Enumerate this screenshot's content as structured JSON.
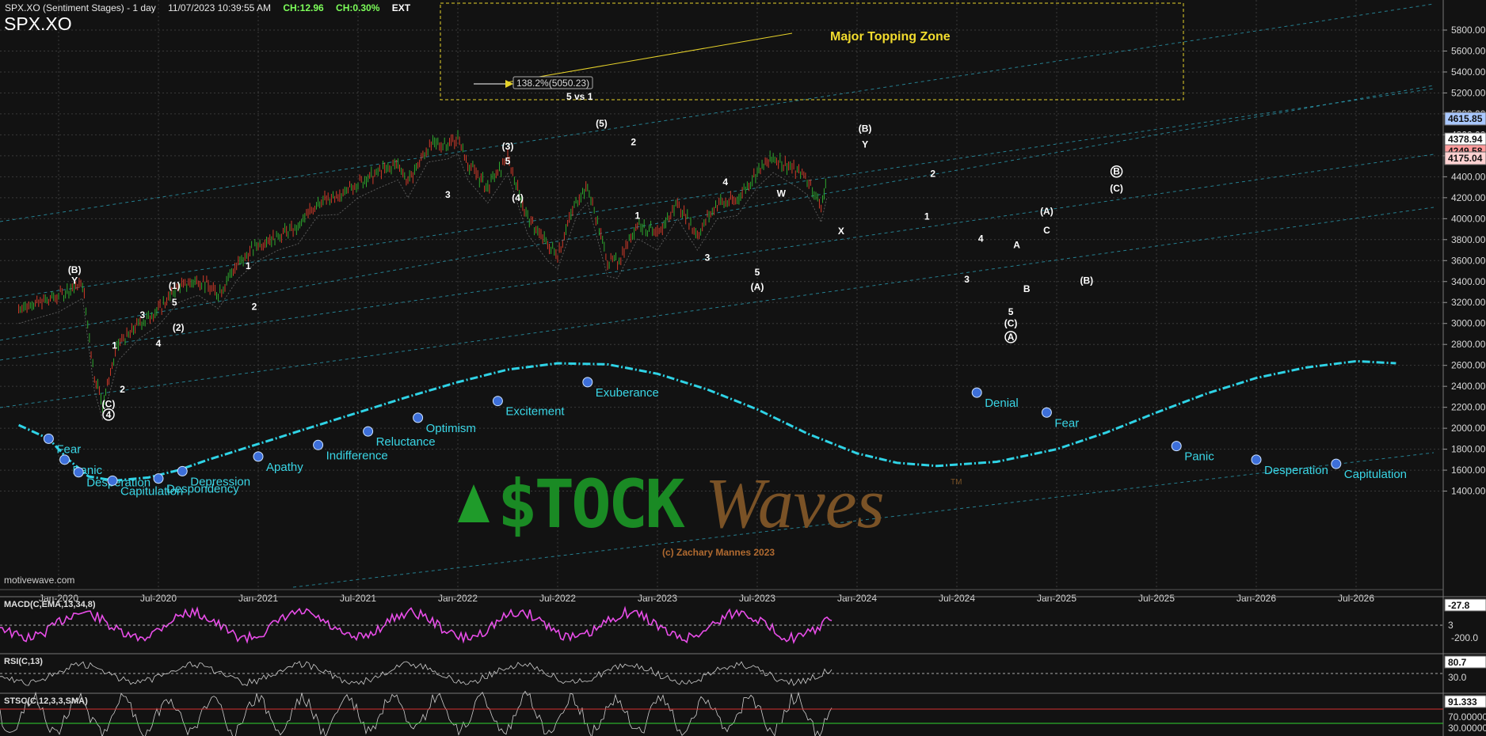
{
  "header": {
    "title": "SPX.XO (Sentiment Stages) - 1 day",
    "datetime": "11/07/2023 10:39:55 AM",
    "change": "CH:12.96",
    "change_pct": "CH:0.30%",
    "session": "EXT",
    "symbol": "SPX.XO"
  },
  "watermark": "motivewave.com",
  "brand": {
    "stock": "STOCK",
    "waves": "Waves",
    "tm": "TM",
    "credit": "(c) Zachary Mannes 2023"
  },
  "zone_label": "Major Topping Zone",
  "fib_label": "138.2%(5050.23)",
  "fib_note": "5 vs 1",
  "colors": {
    "stage_curve": "#2fd3e6",
    "stage_dot": "#3d6fd9",
    "up_candle": "#2ea82e",
    "down_candle": "#d23a2a",
    "zone": "#e6d22a",
    "macd": "#e84de8"
  },
  "chart_data": {
    "type": "line",
    "x_ticks": [
      "Jan-2020",
      "Jul-2020",
      "Jan-2021",
      "Jul-2021",
      "Jan-2022",
      "Jul-2022",
      "Jan-2023",
      "Jul-2023",
      "Jan-2024",
      "Jul-2024",
      "Jan-2025",
      "Jul-2025",
      "Jan-2026",
      "Jul-2026"
    ],
    "y_ticks": [
      1400,
      1600,
      1800,
      2000,
      2200,
      2400,
      2600,
      2800,
      3000,
      3200,
      3400,
      3600,
      3800,
      4000,
      4200,
      4400,
      4600,
      4800,
      5000,
      5200,
      5400,
      5600,
      5800
    ],
    "price_tags": [
      "4615.85",
      "4378.94",
      "4249.58",
      "4175.04"
    ],
    "price_path": [
      [
        2019.8,
        3150
      ],
      [
        2020.0,
        3260
      ],
      [
        2020.12,
        3390
      ],
      [
        2020.18,
        2500
      ],
      [
        2020.22,
        2240
      ],
      [
        2020.3,
        2800
      ],
      [
        2020.4,
        3000
      ],
      [
        2020.5,
        3130
      ],
      [
        2020.6,
        3350
      ],
      [
        2020.7,
        3420
      ],
      [
        2020.8,
        3290
      ],
      [
        2020.9,
        3580
      ],
      [
        2021.0,
        3750
      ],
      [
        2021.1,
        3850
      ],
      [
        2021.2,
        3910
      ],
      [
        2021.3,
        4180
      ],
      [
        2021.4,
        4190
      ],
      [
        2021.5,
        4350
      ],
      [
        2021.6,
        4440
      ],
      [
        2021.7,
        4520
      ],
      [
        2021.75,
        4350
      ],
      [
        2021.85,
        4690
      ],
      [
        2021.95,
        4720
      ],
      [
        2022.0,
        4770
      ],
      [
        2022.05,
        4520
      ],
      [
        2022.15,
        4300
      ],
      [
        2022.25,
        4580
      ],
      [
        2022.35,
        4000
      ],
      [
        2022.45,
        3750
      ],
      [
        2022.5,
        3670
      ],
      [
        2022.6,
        4200
      ],
      [
        2022.65,
        4300
      ],
      [
        2022.75,
        3600
      ],
      [
        2022.8,
        3580
      ],
      [
        2022.9,
        3960
      ],
      [
        2023.0,
        3850
      ],
      [
        2023.1,
        4150
      ],
      [
        2023.2,
        3850
      ],
      [
        2023.3,
        4150
      ],
      [
        2023.4,
        4180
      ],
      [
        2023.5,
        4450
      ],
      [
        2023.58,
        4590
      ],
      [
        2023.7,
        4450
      ],
      [
        2023.75,
        4380
      ],
      [
        2023.82,
        4117
      ],
      [
        2023.85,
        4360
      ]
    ],
    "sentiment_path": [
      [
        2019.8,
        2030
      ],
      [
        2019.95,
        1900
      ],
      [
        2020.05,
        1700
      ],
      [
        2020.15,
        1540
      ],
      [
        2020.28,
        1500
      ],
      [
        2020.45,
        1530
      ],
      [
        2020.6,
        1600
      ],
      [
        2020.75,
        1700
      ],
      [
        2021.0,
        1850
      ],
      [
        2021.25,
        2000
      ],
      [
        2021.5,
        2150
      ],
      [
        2021.75,
        2300
      ],
      [
        2022.0,
        2440
      ],
      [
        2022.25,
        2560
      ],
      [
        2022.5,
        2620
      ],
      [
        2022.75,
        2610
      ],
      [
        2023.0,
        2520
      ],
      [
        2023.25,
        2370
      ],
      [
        2023.5,
        2180
      ],
      [
        2023.75,
        1950
      ],
      [
        2024.0,
        1760
      ],
      [
        2024.2,
        1670
      ],
      [
        2024.4,
        1640
      ],
      [
        2024.7,
        1680
      ],
      [
        2025.0,
        1800
      ],
      [
        2025.25,
        1960
      ],
      [
        2025.5,
        2150
      ],
      [
        2025.75,
        2330
      ],
      [
        2026.0,
        2480
      ],
      [
        2026.25,
        2580
      ],
      [
        2026.5,
        2640
      ],
      [
        2026.7,
        2620
      ]
    ],
    "sentiment_stages": [
      {
        "label": "Fear",
        "x": 2019.95,
        "y": 1900
      },
      {
        "label": "Panic",
        "x": 2020.03,
        "y": 1700
      },
      {
        "label": "Desperation",
        "x": 2020.1,
        "y": 1580
      },
      {
        "label": "Capitulation",
        "x": 2020.27,
        "y": 1500
      },
      {
        "label": "Despondency",
        "x": 2020.5,
        "y": 1520
      },
      {
        "label": "Depression",
        "x": 2020.62,
        "y": 1590
      },
      {
        "label": "Apathy",
        "x": 2021.0,
        "y": 1730
      },
      {
        "label": "Indifference",
        "x": 2021.3,
        "y": 1840
      },
      {
        "label": "Reluctance",
        "x": 2021.55,
        "y": 1970
      },
      {
        "label": "Optimism",
        "x": 2021.8,
        "y": 2100
      },
      {
        "label": "Excitement",
        "x": 2022.2,
        "y": 2260
      },
      {
        "label": "Exuberance",
        "x": 2022.65,
        "y": 2440
      },
      {
        "label": "Denial",
        "x": 2024.6,
        "y": 2340
      },
      {
        "label": "Fear",
        "x": 2024.95,
        "y": 2150
      },
      {
        "label": "Panic",
        "x": 2025.6,
        "y": 1830
      },
      {
        "label": "Desperation",
        "x": 2026.0,
        "y": 1700
      },
      {
        "label": "Capitulation",
        "x": 2026.4,
        "y": 1660
      }
    ],
    "wave_labels": [
      {
        "t": "(B)",
        "x": 2020.08,
        "y": 3480
      },
      {
        "t": "Y",
        "x": 2020.08,
        "y": 3380
      },
      {
        "t": "(C)",
        "x": 2020.25,
        "y": 2200
      },
      {
        "t": "4",
        "x": 2020.25,
        "y": 2100,
        "circle": true
      },
      {
        "t": "1",
        "x": 2020.28,
        "y": 2760
      },
      {
        "t": "2",
        "x": 2020.32,
        "y": 2340
      },
      {
        "t": "3",
        "x": 2020.42,
        "y": 3050
      },
      {
        "t": "4",
        "x": 2020.5,
        "y": 2780
      },
      {
        "t": "(1)",
        "x": 2020.58,
        "y": 3330
      },
      {
        "t": "5",
        "x": 2020.58,
        "y": 3170
      },
      {
        "t": "(2)",
        "x": 2020.6,
        "y": 2930
      },
      {
        "t": "1",
        "x": 2020.95,
        "y": 3520
      },
      {
        "t": "2",
        "x": 2020.98,
        "y": 3130
      },
      {
        "t": "3",
        "x": 2021.95,
        "y": 4200
      },
      {
        "t": "(3)",
        "x": 2022.25,
        "y": 4660
      },
      {
        "t": "5",
        "x": 2022.25,
        "y": 4520
      },
      {
        "t": "(4)",
        "x": 2022.3,
        "y": 4170
      },
      {
        "t": "(5)",
        "x": 2022.72,
        "y": 4880
      },
      {
        "t": "2",
        "x": 2022.88,
        "y": 4700
      },
      {
        "t": "1",
        "x": 2022.9,
        "y": 4000
      },
      {
        "t": "3",
        "x": 2023.25,
        "y": 3600
      },
      {
        "t": "4",
        "x": 2023.34,
        "y": 4320
      },
      {
        "t": "5",
        "x": 2023.5,
        "y": 3460
      },
      {
        "t": "(A)",
        "x": 2023.5,
        "y": 3320
      },
      {
        "t": "W",
        "x": 2023.62,
        "y": 4210
      },
      {
        "t": "X",
        "x": 2023.92,
        "y": 3850
      },
      {
        "t": "(B)",
        "x": 2024.04,
        "y": 4830
      },
      {
        "t": "Y",
        "x": 2024.04,
        "y": 4680
      },
      {
        "t": "2",
        "x": 2024.38,
        "y": 4400
      },
      {
        "t": "1",
        "x": 2024.35,
        "y": 3990
      },
      {
        "t": "4",
        "x": 2024.62,
        "y": 3780
      },
      {
        "t": "3",
        "x": 2024.55,
        "y": 3390
      },
      {
        "t": "5",
        "x": 2024.77,
        "y": 3080
      },
      {
        "t": "(C)",
        "x": 2024.77,
        "y": 2970
      },
      {
        "t": "A",
        "x": 2024.77,
        "y": 2840,
        "circle": true
      },
      {
        "t": "A",
        "x": 2024.8,
        "y": 3720
      },
      {
        "t": "B",
        "x": 2024.85,
        "y": 3300
      },
      {
        "t": "(A)",
        "x": 2024.95,
        "y": 4040
      },
      {
        "t": "C",
        "x": 2024.95,
        "y": 3860
      },
      {
        "t": "(B)",
        "x": 2025.15,
        "y": 3380
      },
      {
        "t": "B",
        "x": 2025.3,
        "y": 4420,
        "circle": true
      },
      {
        "t": "(C)",
        "x": 2025.3,
        "y": 4260
      }
    ]
  },
  "indicators": [
    {
      "label": "MACD(C,EMA,13,34,8)",
      "value": "-27.8",
      "value2": "3",
      "scale": "-200.0"
    },
    {
      "label": "RSI(C,13)",
      "value": "80.7",
      "value2": "30.0"
    },
    {
      "label": "STSC(C,12,3,3,SMA)",
      "value": "91.333",
      "value2": "70.00000",
      "value3": "30.00000"
    }
  ]
}
